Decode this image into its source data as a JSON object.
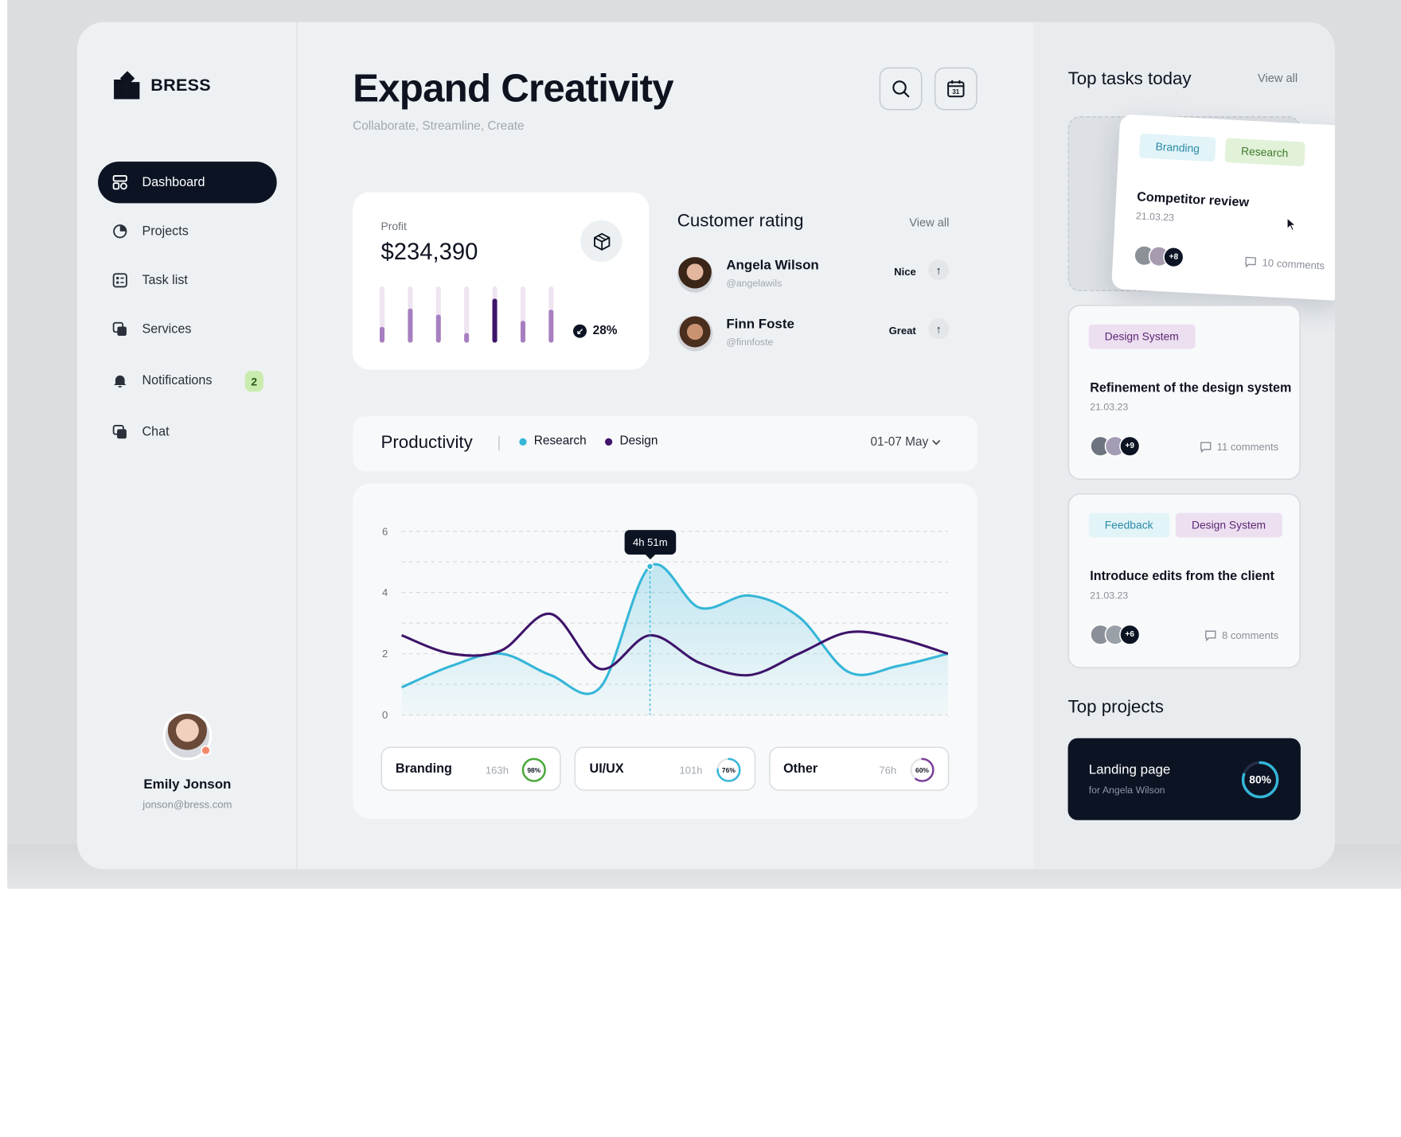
{
  "brand": {
    "name": "BRESS"
  },
  "sidebar": {
    "items": [
      {
        "label": "Dashboard",
        "icon": "dashboard-icon",
        "active": true
      },
      {
        "label": "Projects",
        "icon": "pie-chart-icon"
      },
      {
        "label": "Task list",
        "icon": "task-list-icon"
      },
      {
        "label": "Services",
        "icon": "services-icon"
      },
      {
        "label": "Notifications",
        "icon": "bell-icon",
        "badge": "2"
      },
      {
        "label": "Chat",
        "icon": "chat-icon"
      }
    ],
    "user": {
      "name": "Emily Jonson",
      "email": "jonson@bress.com"
    }
  },
  "header": {
    "title": "Expand Creativity",
    "subtitle": "Collaborate, Streamline, Create",
    "actions": [
      "search-icon",
      "calendar-icon"
    ],
    "calendar_day": "31"
  },
  "profit": {
    "label": "Profit",
    "value": "$234,390",
    "change": "28%",
    "bar_levels": [
      0.28,
      0.6,
      0.5,
      0.17,
      0.78,
      0.4,
      0.58
    ]
  },
  "customer_rating": {
    "title": "Customer rating",
    "view_all": "View all",
    "rows": [
      {
        "name": "Angela Wilson",
        "handle": "@angelawils",
        "rating": "Nice"
      },
      {
        "name": "Finn Foste",
        "handle": "@finnfoste",
        "rating": "Great"
      }
    ]
  },
  "productivity": {
    "title": "Productivity",
    "legend": [
      {
        "name": "Research",
        "color": "#35b6d8"
      },
      {
        "name": "Design",
        "color": "#3e136a"
      }
    ],
    "date_range": "01-07 May",
    "tooltip": "4h 51m",
    "categories": [
      {
        "label": "Branding",
        "hours": "163h",
        "percent": "98%",
        "value": 0.98,
        "color": "#49a838"
      },
      {
        "label": "UI/UX",
        "hours": "101h",
        "percent": "76%",
        "value": 0.76,
        "color": "#35b6d8"
      },
      {
        "label": "Other",
        "hours": "76h",
        "percent": "60%",
        "value": 0.6,
        "color": "#7a3e9a"
      }
    ]
  },
  "chart_data": {
    "type": "line",
    "x": [
      0,
      1,
      2,
      3,
      4,
      5,
      6,
      7,
      8,
      9,
      10,
      11
    ],
    "ylim": [
      0,
      6
    ],
    "yticks": [
      "0",
      "2",
      "4",
      "6"
    ],
    "grid": true,
    "legend_position": "top",
    "series": [
      {
        "name": "Research",
        "color": "#35b6d8",
        "values": [
          0.9,
          1.6,
          2.0,
          1.3,
          0.9,
          4.85,
          3.5,
          3.9,
          3.2,
          1.4,
          1.6,
          2.0
        ]
      },
      {
        "name": "Design",
        "color": "#3e136a",
        "values": [
          2.6,
          2.0,
          2.1,
          3.3,
          1.5,
          2.6,
          1.7,
          1.3,
          2.0,
          2.7,
          2.5,
          2.0
        ]
      }
    ],
    "highlight": {
      "series": "Research",
      "index": 5,
      "label": "4h 51m"
    }
  },
  "tasks": {
    "title": "Top tasks today",
    "view_all": "View all",
    "items": [
      {
        "tags": [
          {
            "label": "Branding",
            "bg": "#e2f4f8",
            "fg": "#2b8aa6"
          },
          {
            "label": "Research",
            "bg": "#e1f2d9",
            "fg": "#3f7a2a"
          }
        ],
        "title": "Competitor review",
        "date": "21.03.23",
        "extra": "+8",
        "comments": "10 comments"
      },
      {
        "tags": [
          {
            "label": "Design System",
            "bg": "#ecdff0",
            "fg": "#5c2675"
          }
        ],
        "title": "Refinement of the design system",
        "date": "21.03.23",
        "extra": "+9",
        "comments": "11 comments"
      },
      {
        "tags": [
          {
            "label": "Feedback",
            "bg": "#e2f4f8",
            "fg": "#2b8aa6"
          },
          {
            "label": "Design System",
            "bg": "#ecdff0",
            "fg": "#5c2675"
          }
        ],
        "title": "Introduce edits from the client",
        "date": "21.03.23",
        "extra": "+6",
        "comments": "8 comments"
      }
    ]
  },
  "projects": {
    "title": "Top projects",
    "items": [
      {
        "name": "Landing page",
        "owner": "for Angela Wilson",
        "percent": "80%",
        "value": 0.8
      }
    ]
  }
}
